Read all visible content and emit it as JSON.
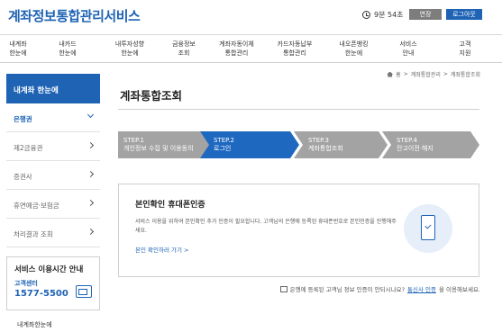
{
  "header": {
    "title": "계좌정보통합관리서비스",
    "timer": "9분 54초",
    "extend_label": "연장",
    "logout_label": "로그아웃"
  },
  "gnb": [
    {
      "label": "내계좌\n한눈에"
    },
    {
      "label": "내카드\n한눈에"
    },
    {
      "label": "내투자성향\n한눈에"
    },
    {
      "label": "금융정보\n조회"
    },
    {
      "label": "계좌자동이체\n통합관리"
    },
    {
      "label": "카드자동납부\n통합관리"
    },
    {
      "label": "내오픈뱅킹\n한눈에"
    },
    {
      "label": "서비스\n안내"
    },
    {
      "label": "고객\n지원"
    }
  ],
  "sidebar": {
    "title": "내계좌 한눈에",
    "items": [
      {
        "label": "은행권"
      },
      {
        "label": "제2금융권"
      },
      {
        "label": "증권사"
      },
      {
        "label": "휴면예금·보험금"
      },
      {
        "label": "처리결과 조회"
      }
    ],
    "service_box": {
      "title": "서비스 이용시간 안내",
      "subtitle": "고객센터",
      "phone": "1577-5500"
    },
    "footer": "내계좌한눈에"
  },
  "breadcrumb": [
    "홈",
    "계좌통합관리",
    "계좌통합조회"
  ],
  "page_title": "계좌통합조회",
  "steps": [
    {
      "num": "STEP.1",
      "desc": "개인정보 수집 및 이용동의"
    },
    {
      "num": "STEP.2",
      "desc": "로그인"
    },
    {
      "num": "STEP.3",
      "desc": "계좌통합조회"
    },
    {
      "num": "STEP.4",
      "desc": "잔고이전·해지"
    }
  ],
  "cert": {
    "title": "본인확인 휴대폰인증",
    "desc": "서비스 이용을 위하여 본인확인 추가 인증이 필요합니다. 고객님의 은행에 등록된 휴대폰번호로 본인인증을 진행해주세요.",
    "link": "본인 확인하러 가기 >"
  },
  "note": {
    "text_before": "은행에 등록된 고객님 정보 인증이 안되시나요?",
    "link": "통신사 인증",
    "text_after": "을 이용해보세요."
  }
}
